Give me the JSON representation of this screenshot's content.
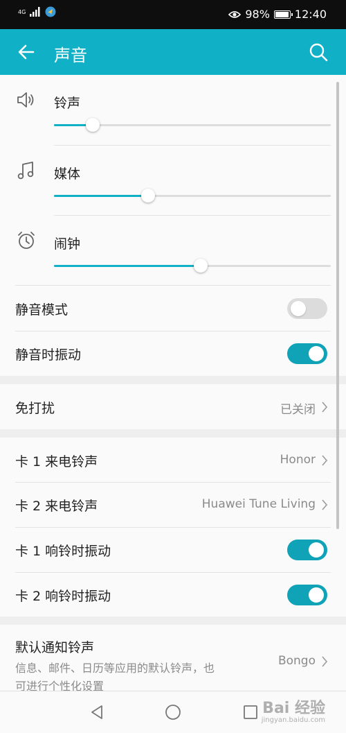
{
  "status_bar": {
    "network": "4G",
    "battery_percent": "98%",
    "battery_level": 0.98,
    "time": "12:40"
  },
  "app_bar": {
    "title": "声音",
    "back_icon": "arrow-left-icon",
    "search_icon": "search-icon"
  },
  "volumes": [
    {
      "label": "铃声",
      "icon": "speaker-icon",
      "level": 0.14
    },
    {
      "label": "媒体",
      "icon": "music-note-icon",
      "level": 0.34
    },
    {
      "label": "闹钟",
      "icon": "alarm-clock-icon",
      "level": 0.53
    }
  ],
  "toggles": {
    "silent_mode": {
      "label": "静音模式",
      "on": false
    },
    "vibrate_silent": {
      "label": "静音时振动",
      "on": true
    }
  },
  "dnd": {
    "label": "免打扰",
    "value": "已关闭"
  },
  "sim": {
    "card1_ringtone": {
      "label": "卡 1 来电铃声",
      "value": "Honor"
    },
    "card2_ringtone": {
      "label": "卡 2 来电铃声",
      "value": "Huawei Tune Living"
    },
    "card1_vibrate": {
      "label": "卡 1 响铃时振动",
      "on": true
    },
    "card2_vibrate": {
      "label": "卡 2 响铃时振动",
      "on": true
    }
  },
  "notification": {
    "label": "默认通知铃声",
    "description": "信息、邮件、日历等应用的默认铃声，也可进行个性化设置",
    "value": "Bongo"
  },
  "watermark": {
    "text": "Bai 经验",
    "sub": "jingyan.baidu.com"
  },
  "colors": {
    "accent": "#10b0c6",
    "toggle_on": "#10a3b8",
    "status_bar": "#0e0e0e"
  }
}
